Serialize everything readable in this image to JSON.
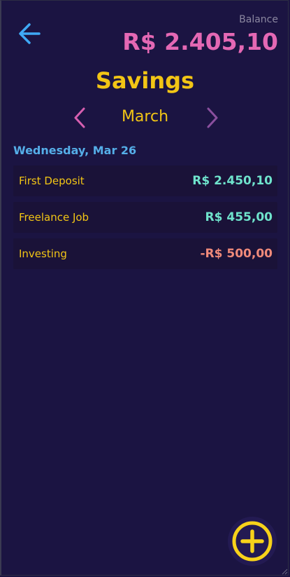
{
  "header": {
    "balance_label": "Balance",
    "balance_value": "R$ 2.405,10"
  },
  "page": {
    "title": "Savings"
  },
  "month_nav": {
    "month": "March"
  },
  "day": {
    "date_label": "Wednesday, Mar 26"
  },
  "transactions": [
    {
      "name": "First Deposit",
      "amount": "R$ 2.450,10",
      "kind": "income"
    },
    {
      "name": "Freelance Job",
      "amount": "R$ 455,00",
      "kind": "income"
    },
    {
      "name": "Investing",
      "amount": "-R$ 500,00",
      "kind": "expense"
    }
  ],
  "colors": {
    "background": "#1b1442",
    "accent_yellow": "#f2c515",
    "balance_pink": "#e468b4",
    "income_teal": "#6fe3cc",
    "expense_salmon": "#f08a7a",
    "date_blue": "#55aee8",
    "back_arrow_blue": "#3fa9f5"
  },
  "icons": {
    "back": "arrow-left-icon",
    "prev_month": "chevron-left-icon",
    "next_month": "chevron-right-icon",
    "add": "plus-circle-icon"
  }
}
